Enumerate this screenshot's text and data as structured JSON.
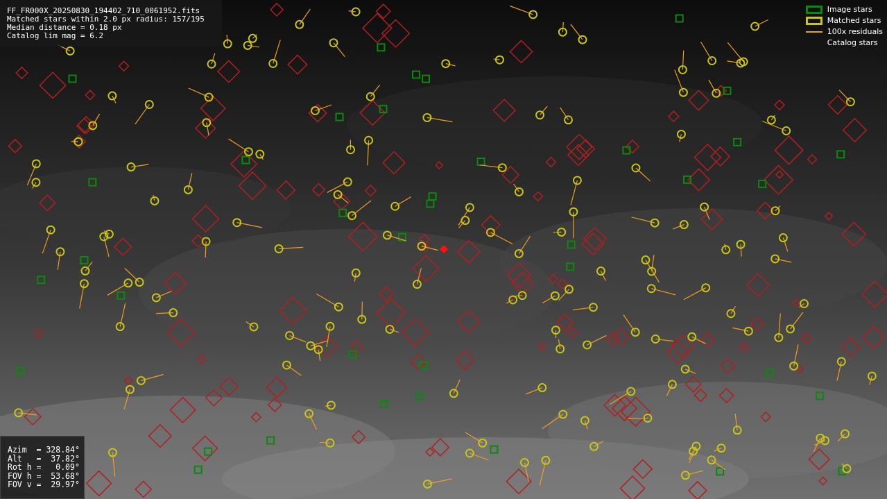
{
  "info_box": {
    "lines": [
      "FF_FR000X_20250830_194402_710_0061952.fits",
      "Matched stars within 2.0 px radius: 157/195",
      "Median distance = 0.18 px",
      "Catalog lim mag = 6.2"
    ]
  },
  "legend": [
    {
      "label": "Image stars"
    },
    {
      "kind": "matched",
      "label": "Matched stars"
    },
    {
      "kind": "residual",
      "label": "100x residuals"
    },
    {
      "kind": "catalog",
      "label": "Catalog stars"
    }
  ],
  "pointing_box": {
    "lines": [
      "Azim  = 328.84°",
      "Alt   =  37.82°",
      "Rot h =   0.09°",
      "FOV h =  53.68°",
      "FOV v =  29.97°"
    ]
  }
}
